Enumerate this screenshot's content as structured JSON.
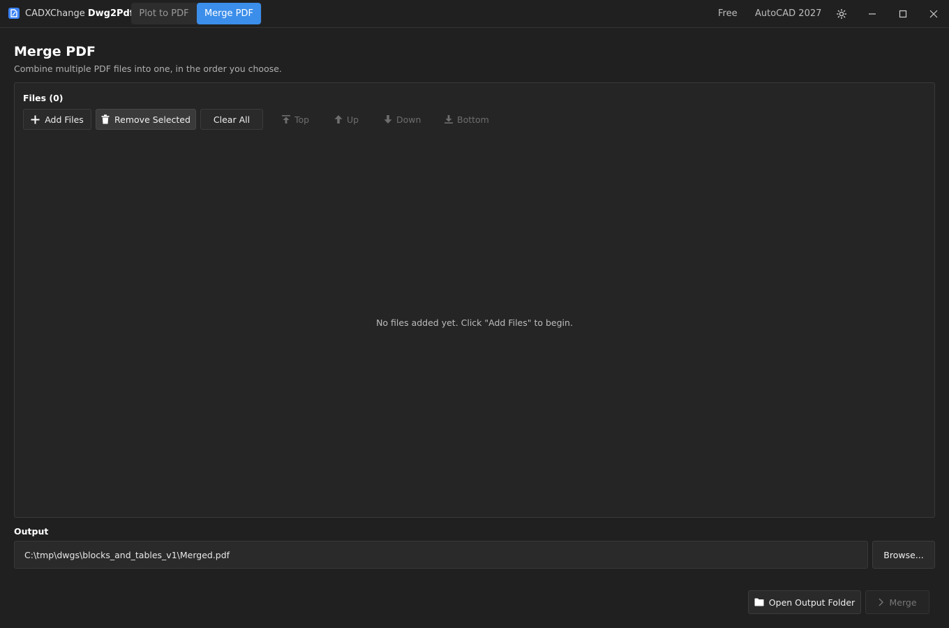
{
  "titlebar": {
    "app_name": "CADXChange",
    "app_product": "Dwg2Pdf",
    "tabs": [
      {
        "label": "Plot to PDF",
        "active": false
      },
      {
        "label": "Merge PDF",
        "active": true
      }
    ],
    "license": "Free",
    "autocad_version": "AutoCAD 2027",
    "icons": {
      "theme": "sun-icon",
      "minimize": "minimize-icon",
      "maximize": "maximize-icon",
      "close": "close-icon"
    }
  },
  "page": {
    "title": "Merge PDF",
    "subtitle": "Combine multiple PDF files into one, in the order you choose."
  },
  "files": {
    "label": "Files (0)",
    "toolbar": {
      "add": "Add Files",
      "remove": "Remove Selected",
      "clear": "Clear All",
      "top": "Top",
      "up": "Up",
      "down": "Down",
      "bottom": "Bottom"
    },
    "empty_message": "No files added yet. Click \"Add Files\" to begin.",
    "items": []
  },
  "output": {
    "label": "Output",
    "path": "C:\\tmp\\dwgs\\blocks_and_tables_v1\\Merged.pdf",
    "browse": "Browse..."
  },
  "actions": {
    "open_folder": "Open Output Folder",
    "merge": "Merge"
  },
  "colors": {
    "background": "#202020",
    "accent": "#3b8eea",
    "panel": "#252525"
  }
}
